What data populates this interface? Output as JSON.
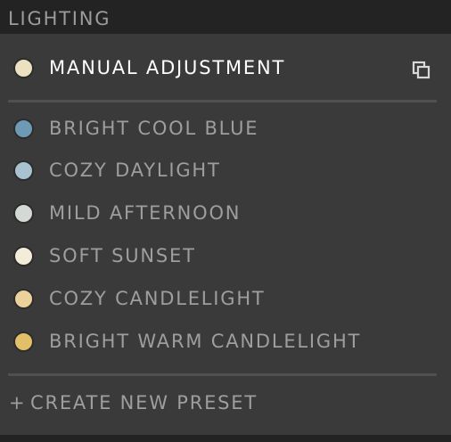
{
  "panel": {
    "title": "LIGHTING"
  },
  "manual": {
    "label": "MANUAL ADJUSTMENT",
    "color": "#ece1c0",
    "icon": "copy-icon"
  },
  "presets": [
    {
      "label": "BRIGHT COOL BLUE",
      "color": "#6e9ab5"
    },
    {
      "label": "COZY DAYLIGHT",
      "color": "#a9c2cf"
    },
    {
      "label": "MILD AFTERNOON",
      "color": "#d3d9d5"
    },
    {
      "label": "SOFT SUNSET",
      "color": "#f2ecd9"
    },
    {
      "label": "COZY CANDLELIGHT",
      "color": "#ecd29a"
    },
    {
      "label": "BRIGHT WARM CANDLELIGHT",
      "color": "#e2c067"
    }
  ],
  "create": {
    "plus": "+",
    "label": "CREATE NEW PRESET"
  }
}
